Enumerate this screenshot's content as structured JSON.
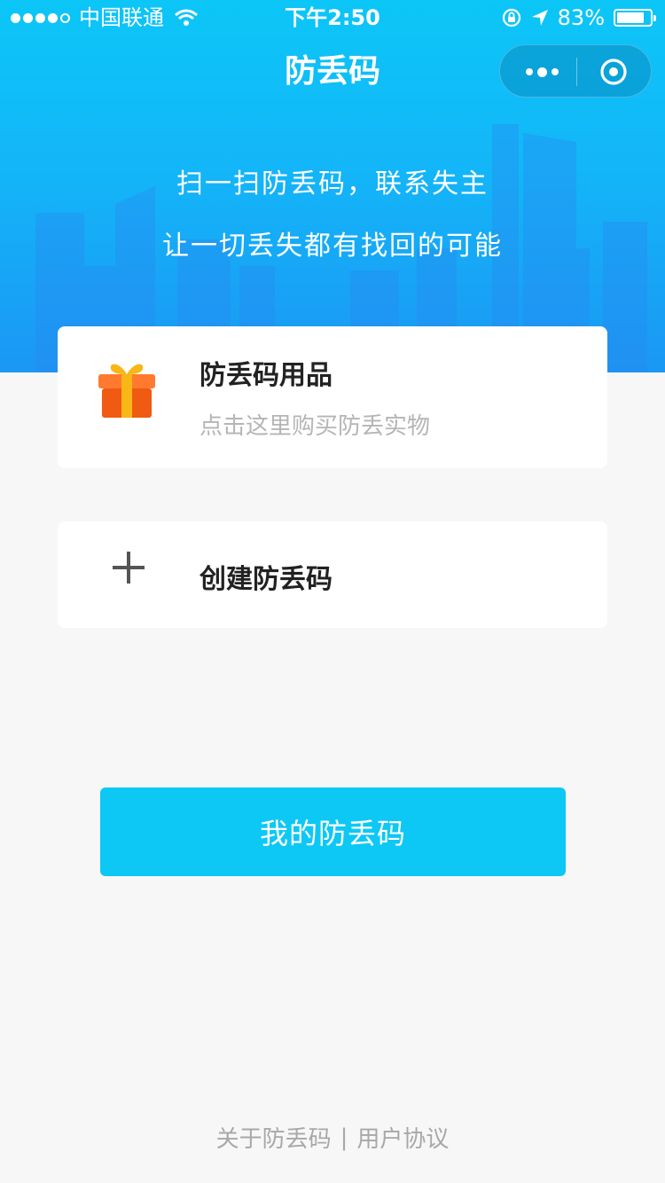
{
  "status_bar": {
    "carrier": "中国联通",
    "time": "下午2:50",
    "battery_text": "83%",
    "battery_level": 0.83
  },
  "nav": {
    "title": "防丢码"
  },
  "hero": {
    "line1": "扫一扫防丢码，联系失主",
    "line2": "让一切丢失都有找回的可能"
  },
  "cards": {
    "shop": {
      "title": "防丢码用品",
      "subtitle": "点击这里购买防丢实物",
      "icon": "gift-icon"
    },
    "create": {
      "title": "创建防丢码",
      "icon": "plus-icon"
    }
  },
  "primary_button": {
    "label": "我的防丢码"
  },
  "footer": {
    "about": "关于防丢码",
    "separator": "|",
    "agreement": "用户协议"
  },
  "colors": {
    "hero_top": "#0cc6f7",
    "hero_bottom": "#1b97f4",
    "button": "#0dc8f5",
    "background": "#f7f7f7"
  }
}
